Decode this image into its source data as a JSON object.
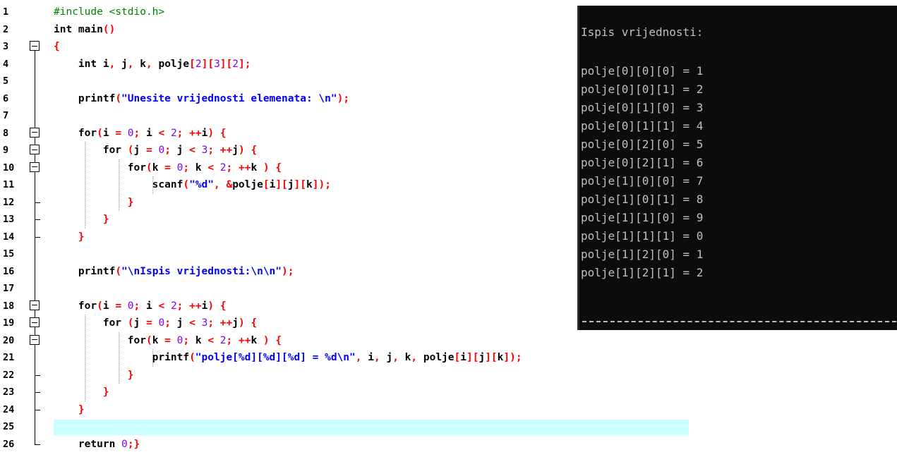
{
  "editor": {
    "line_numbers": [
      "1",
      "2",
      "3",
      "4",
      "5",
      "6",
      "7",
      "8",
      "9",
      "10",
      "11",
      "12",
      "13",
      "14",
      "15",
      "16",
      "17",
      "18",
      "19",
      "20",
      "21",
      "22",
      "23",
      "24",
      "25",
      "26"
    ],
    "current_line": "25",
    "lines": [
      {
        "n": 1,
        "fold": "",
        "tokens": [
          [
            "pre",
            "#include <stdio.h>"
          ]
        ]
      },
      {
        "n": 2,
        "fold": "",
        "tokens": [
          [
            "kw",
            "int"
          ],
          [
            "id",
            " main"
          ],
          [
            "br",
            "()"
          ]
        ]
      },
      {
        "n": 3,
        "fold": "open",
        "tokens": [
          [
            "br",
            "{"
          ]
        ]
      },
      {
        "n": 4,
        "fold": "line",
        "tokens": [
          [
            "id",
            "    "
          ],
          [
            "kw",
            "int"
          ],
          [
            "id",
            " i"
          ],
          [
            "op",
            ","
          ],
          [
            "id",
            " j"
          ],
          [
            "op",
            ","
          ],
          [
            "id",
            " k"
          ],
          [
            "op",
            ","
          ],
          [
            "id",
            " polje"
          ],
          [
            "br",
            "["
          ],
          [
            "num",
            "2"
          ],
          [
            "br",
            "]["
          ],
          [
            "num",
            "3"
          ],
          [
            "br",
            "]["
          ],
          [
            "num",
            "2"
          ],
          [
            "br",
            "]"
          ],
          [
            "op",
            ";"
          ]
        ]
      },
      {
        "n": 5,
        "fold": "line",
        "tokens": []
      },
      {
        "n": 6,
        "fold": "line",
        "tokens": [
          [
            "id",
            "    printf"
          ],
          [
            "br",
            "("
          ],
          [
            "str",
            "\"Unesite vrijednosti elemenata: \\n\""
          ],
          [
            "br",
            ")"
          ],
          [
            "op",
            ";"
          ]
        ]
      },
      {
        "n": 7,
        "fold": "line",
        "tokens": []
      },
      {
        "n": 8,
        "fold": "open",
        "tokens": [
          [
            "id",
            "    "
          ],
          [
            "kw",
            "for"
          ],
          [
            "br",
            "("
          ],
          [
            "id",
            "i "
          ],
          [
            "op",
            "="
          ],
          [
            "id",
            " "
          ],
          [
            "num",
            "0"
          ],
          [
            "op",
            ";"
          ],
          [
            "id",
            " i "
          ],
          [
            "op",
            "<"
          ],
          [
            "id",
            " "
          ],
          [
            "num",
            "2"
          ],
          [
            "op",
            ";"
          ],
          [
            "id",
            " "
          ],
          [
            "op",
            "++"
          ],
          [
            "id",
            "i"
          ],
          [
            "br",
            ")"
          ],
          [
            "id",
            " "
          ],
          [
            "br",
            "{"
          ]
        ]
      },
      {
        "n": 9,
        "fold": "open",
        "tokens": [
          [
            "id",
            "        "
          ],
          [
            "kw",
            "for"
          ],
          [
            "id",
            " "
          ],
          [
            "br",
            "("
          ],
          [
            "id",
            "j "
          ],
          [
            "op",
            "="
          ],
          [
            "id",
            " "
          ],
          [
            "num",
            "0"
          ],
          [
            "op",
            ";"
          ],
          [
            "id",
            " j "
          ],
          [
            "op",
            "<"
          ],
          [
            "id",
            " "
          ],
          [
            "num",
            "3"
          ],
          [
            "op",
            ";"
          ],
          [
            "id",
            " "
          ],
          [
            "op",
            "++"
          ],
          [
            "id",
            "j"
          ],
          [
            "br",
            ")"
          ],
          [
            "id",
            " "
          ],
          [
            "br",
            "{"
          ]
        ]
      },
      {
        "n": 10,
        "fold": "open",
        "tokens": [
          [
            "id",
            "            "
          ],
          [
            "kw",
            "for"
          ],
          [
            "br",
            "("
          ],
          [
            "id",
            "k "
          ],
          [
            "op",
            "="
          ],
          [
            "id",
            " "
          ],
          [
            "num",
            "0"
          ],
          [
            "op",
            ";"
          ],
          [
            "id",
            " k "
          ],
          [
            "op",
            "<"
          ],
          [
            "id",
            " "
          ],
          [
            "num",
            "2"
          ],
          [
            "op",
            ";"
          ],
          [
            "id",
            " "
          ],
          [
            "op",
            "++"
          ],
          [
            "id",
            "k "
          ],
          [
            "br",
            ")"
          ],
          [
            "id",
            " "
          ],
          [
            "br",
            "{"
          ]
        ]
      },
      {
        "n": 11,
        "fold": "line",
        "tokens": [
          [
            "id",
            "                scanf"
          ],
          [
            "br",
            "("
          ],
          [
            "str",
            "\"%d\""
          ],
          [
            "op",
            ","
          ],
          [
            "id",
            " "
          ],
          [
            "op",
            "&"
          ],
          [
            "id",
            "polje"
          ],
          [
            "br",
            "["
          ],
          [
            "id",
            "i"
          ],
          [
            "br",
            "]["
          ],
          [
            "id",
            "j"
          ],
          [
            "br",
            "]["
          ],
          [
            "id",
            "k"
          ],
          [
            "br",
            "])"
          ],
          [
            "op",
            ";"
          ]
        ]
      },
      {
        "n": 12,
        "fold": "end",
        "tokens": [
          [
            "id",
            "            "
          ],
          [
            "br",
            "}"
          ]
        ]
      },
      {
        "n": 13,
        "fold": "end",
        "tokens": [
          [
            "id",
            "        "
          ],
          [
            "br",
            "}"
          ]
        ]
      },
      {
        "n": 14,
        "fold": "end",
        "tokens": [
          [
            "id",
            "    "
          ],
          [
            "br",
            "}"
          ]
        ]
      },
      {
        "n": 15,
        "fold": "line",
        "tokens": []
      },
      {
        "n": 16,
        "fold": "line",
        "tokens": [
          [
            "id",
            "    printf"
          ],
          [
            "br",
            "("
          ],
          [
            "str",
            "\"\\nIspis vrijednosti:\\n\\n\""
          ],
          [
            "br",
            ")"
          ],
          [
            "op",
            ";"
          ]
        ]
      },
      {
        "n": 17,
        "fold": "line",
        "tokens": []
      },
      {
        "n": 18,
        "fold": "open",
        "tokens": [
          [
            "id",
            "    "
          ],
          [
            "kw",
            "for"
          ],
          [
            "br",
            "("
          ],
          [
            "id",
            "i "
          ],
          [
            "op",
            "="
          ],
          [
            "id",
            " "
          ],
          [
            "num",
            "0"
          ],
          [
            "op",
            ";"
          ],
          [
            "id",
            " i "
          ],
          [
            "op",
            "<"
          ],
          [
            "id",
            " "
          ],
          [
            "num",
            "2"
          ],
          [
            "op",
            ";"
          ],
          [
            "id",
            " "
          ],
          [
            "op",
            "++"
          ],
          [
            "id",
            "i"
          ],
          [
            "br",
            ")"
          ],
          [
            "id",
            " "
          ],
          [
            "br",
            "{"
          ]
        ]
      },
      {
        "n": 19,
        "fold": "open",
        "tokens": [
          [
            "id",
            "        "
          ],
          [
            "kw",
            "for"
          ],
          [
            "id",
            " "
          ],
          [
            "br",
            "("
          ],
          [
            "id",
            "j "
          ],
          [
            "op",
            "="
          ],
          [
            "id",
            " "
          ],
          [
            "num",
            "0"
          ],
          [
            "op",
            ";"
          ],
          [
            "id",
            " j "
          ],
          [
            "op",
            "<"
          ],
          [
            "id",
            " "
          ],
          [
            "num",
            "3"
          ],
          [
            "op",
            ";"
          ],
          [
            "id",
            " "
          ],
          [
            "op",
            "++"
          ],
          [
            "id",
            "j"
          ],
          [
            "br",
            ")"
          ],
          [
            "id",
            " "
          ],
          [
            "br",
            "{"
          ]
        ]
      },
      {
        "n": 20,
        "fold": "open",
        "tokens": [
          [
            "id",
            "            "
          ],
          [
            "kw",
            "for"
          ],
          [
            "br",
            "("
          ],
          [
            "id",
            "k "
          ],
          [
            "op",
            "="
          ],
          [
            "id",
            " "
          ],
          [
            "num",
            "0"
          ],
          [
            "op",
            ";"
          ],
          [
            "id",
            " k "
          ],
          [
            "op",
            "<"
          ],
          [
            "id",
            " "
          ],
          [
            "num",
            "2"
          ],
          [
            "op",
            ";"
          ],
          [
            "id",
            " "
          ],
          [
            "op",
            "++"
          ],
          [
            "id",
            "k "
          ],
          [
            "br",
            ")"
          ],
          [
            "id",
            " "
          ],
          [
            "br",
            "{"
          ]
        ]
      },
      {
        "n": 21,
        "fold": "line",
        "tokens": [
          [
            "id",
            "                printf"
          ],
          [
            "br",
            "("
          ],
          [
            "str",
            "\"polje[%d][%d][%d] = %d\\n\""
          ],
          [
            "op",
            ","
          ],
          [
            "id",
            " i"
          ],
          [
            "op",
            ","
          ],
          [
            "id",
            " j"
          ],
          [
            "op",
            ","
          ],
          [
            "id",
            " k"
          ],
          [
            "op",
            ","
          ],
          [
            "id",
            " polje"
          ],
          [
            "br",
            "["
          ],
          [
            "id",
            "i"
          ],
          [
            "br",
            "]["
          ],
          [
            "id",
            "j"
          ],
          [
            "br",
            "]["
          ],
          [
            "id",
            "k"
          ],
          [
            "br",
            "])"
          ],
          [
            "op",
            ";"
          ]
        ]
      },
      {
        "n": 22,
        "fold": "end",
        "tokens": [
          [
            "id",
            "            "
          ],
          [
            "br",
            "}"
          ]
        ]
      },
      {
        "n": 23,
        "fold": "end",
        "tokens": [
          [
            "id",
            "        "
          ],
          [
            "br",
            "}"
          ]
        ]
      },
      {
        "n": 24,
        "fold": "end",
        "tokens": [
          [
            "id",
            "    "
          ],
          [
            "br",
            "}"
          ]
        ]
      },
      {
        "n": 25,
        "fold": "line",
        "tokens": []
      },
      {
        "n": 26,
        "fold": "close",
        "tokens": [
          [
            "id",
            "    "
          ],
          [
            "kw",
            "return"
          ],
          [
            "id",
            " "
          ],
          [
            "num",
            "0"
          ],
          [
            "op",
            ";"
          ],
          [
            "br",
            "}"
          ]
        ]
      }
    ]
  },
  "console": {
    "header": "Ispis vrijednosti:",
    "lines": [
      "polje[0][0][0] = 1",
      "polje[0][0][1] = 2",
      "polje[0][1][0] = 3",
      "polje[0][1][1] = 4",
      "polje[0][2][0] = 5",
      "polje[0][2][1] = 6",
      "polje[1][0][0] = 7",
      "polje[1][0][1] = 8",
      "polje[1][1][0] = 9",
      "polje[1][1][1] = 0",
      "polje[1][2][0] = 1",
      "polje[1][2][1] = 2"
    ],
    "background": "#0c0c0c",
    "foreground": "#c0c0c0"
  }
}
